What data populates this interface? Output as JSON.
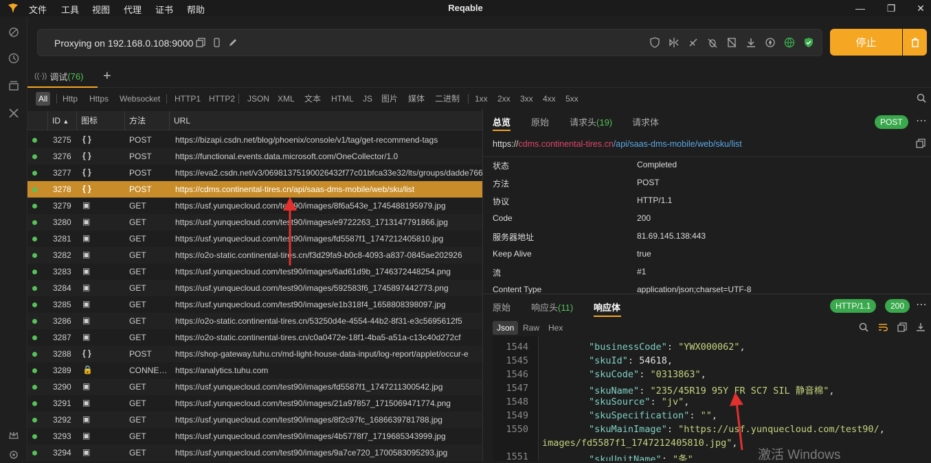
{
  "window": {
    "title": "Reqable",
    "menu": [
      "文件",
      "工具",
      "视图",
      "代理",
      "证书",
      "帮助"
    ]
  },
  "proxy": {
    "status": "Proxying on 192.168.0.108:9000",
    "stop_label": "停止"
  },
  "tabs": [
    {
      "label": "调试",
      "count": "(76)"
    }
  ],
  "filters": [
    "All",
    "Http",
    "Https",
    "Websocket",
    "HTTP1",
    "HTTP2",
    "JSON",
    "XML",
    "文本",
    "HTML",
    "JS",
    "图片",
    "媒体",
    "二进制",
    "1xx",
    "2xx",
    "3xx",
    "4xx",
    "5xx"
  ],
  "list": {
    "columns": [
      "ID",
      "图标",
      "方法",
      "URL"
    ],
    "rows": [
      {
        "id": "3275",
        "icon": "{ }",
        "method": "POST",
        "url": "https://bizapi.csdn.net/blog/phoenix/console/v1/tag/get-recommend-tags"
      },
      {
        "id": "3276",
        "icon": "{ }",
        "method": "POST",
        "url": "https://functional.events.data.microsoft.com/OneCollector/1.0"
      },
      {
        "id": "3277",
        "icon": "{ }",
        "method": "POST",
        "url": "https://eva2.csdn.net/v3/06981375190026432f77c01bfca33e32/lts/groups/dadde766"
      },
      {
        "id": "3278",
        "icon": "{ }",
        "method": "POST",
        "url": "https://cdms.continental-tires.cn/api/saas-dms-mobile/web/sku/list",
        "selected": true
      },
      {
        "id": "3279",
        "icon": "▣",
        "method": "GET",
        "url": "https://usf.yunquecloud.com/test90/images/8f6a543e_1745488195979.jpg"
      },
      {
        "id": "3280",
        "icon": "▣",
        "method": "GET",
        "url": "https://usf.yunquecloud.com/test90/images/e9722263_1713147791866.jpg"
      },
      {
        "id": "3281",
        "icon": "▣",
        "method": "GET",
        "url": "https://usf.yunquecloud.com/test90/images/fd5587f1_1747212405810.jpg"
      },
      {
        "id": "3282",
        "icon": "▣",
        "method": "GET",
        "url": "https://o2o-static.continental-tires.cn/f3d29fa9-b0c8-4093-a837-0845ae202926"
      },
      {
        "id": "3283",
        "icon": "▣",
        "method": "GET",
        "url": "https://usf.yunquecloud.com/test90/images/6ad61d9b_1746372448254.png"
      },
      {
        "id": "3284",
        "icon": "▣",
        "method": "GET",
        "url": "https://usf.yunquecloud.com/test90/images/592583f6_1745897442773.png"
      },
      {
        "id": "3285",
        "icon": "▣",
        "method": "GET",
        "url": "https://usf.yunquecloud.com/test90/images/e1b318f4_1658808398097.jpg"
      },
      {
        "id": "3286",
        "icon": "▣",
        "method": "GET",
        "url": "https://o2o-static.continental-tires.cn/53250d4e-4554-44b2-8f31-e3c5695612f5"
      },
      {
        "id": "3287",
        "icon": "▣",
        "method": "GET",
        "url": "https://o2o-static.continental-tires.cn/c0a0472e-18f1-4ba5-a51a-c13c40d272cf"
      },
      {
        "id": "3288",
        "icon": "{ }",
        "method": "POST",
        "url": "https://shop-gateway.tuhu.cn/md-light-house-data-input/log-report/applet/occur-e"
      },
      {
        "id": "3289",
        "icon": "🔒",
        "method": "CONNE…",
        "url": "https://analytics.tuhu.com"
      },
      {
        "id": "3290",
        "icon": "▣",
        "method": "GET",
        "url": "https://usf.yunquecloud.com/test90/images/fd5587f1_1747211300542.jpg"
      },
      {
        "id": "3291",
        "icon": "▣",
        "method": "GET",
        "url": "https://usf.yunquecloud.com/test90/images/21a97857_1715069471774.png"
      },
      {
        "id": "3292",
        "icon": "▣",
        "method": "GET",
        "url": "https://usf.yunquecloud.com/test90/images/8f2c97fc_1686639781788.jpg"
      },
      {
        "id": "3293",
        "icon": "▣",
        "method": "GET",
        "url": "https://usf.yunquecloud.com/test90/images/4b5778f7_1719685343999.jpg"
      },
      {
        "id": "3294",
        "icon": "▣",
        "method": "GET",
        "url": "https://usf.yunquecloud.com/test90/images/9a7ce720_1700583095293.jpg"
      }
    ]
  },
  "detail": {
    "tabs": [
      {
        "label": "总览"
      },
      {
        "label": "原始"
      },
      {
        "label": "请求头",
        "count": "(19)"
      },
      {
        "label": "请求体"
      }
    ],
    "method_badge": "POST",
    "url": {
      "scheme": "https://",
      "host": "cdms.continental-tires.cn",
      "path": "/api/saas-dms-mobile/web/sku/list"
    },
    "props": [
      {
        "k": "状态",
        "v": "Completed"
      },
      {
        "k": "方法",
        "v": "POST"
      },
      {
        "k": "协议",
        "v": "HTTP/1.1"
      },
      {
        "k": "Code",
        "v": "200"
      },
      {
        "k": "服务器地址",
        "v": "81.69.145.138:443"
      },
      {
        "k": "Keep Alive",
        "v": "true"
      },
      {
        "k": "流",
        "v": "#1"
      },
      {
        "k": "Content Type",
        "v": "application/json;charset=UTF-8"
      }
    ],
    "resp_tabs": [
      {
        "label": "原始"
      },
      {
        "label": "响应头",
        "count": "(11)"
      },
      {
        "label": "响应体"
      }
    ],
    "http_badge": "HTTP/1.1",
    "code_badge": "200",
    "formats": [
      "Json",
      "Raw",
      "Hex"
    ],
    "code_lines": [
      {
        "n": "1544",
        "key": "businessCode",
        "val": "\"YWX000062\""
      },
      {
        "n": "1545",
        "key": "skuId",
        "val": "54618"
      },
      {
        "n": "1546",
        "key": "skuCode",
        "val": "\"0313863\""
      },
      {
        "n": "1547",
        "key": "skuName",
        "val": "\"235/45R19 95Y FR SC7 SIL 静音棉\""
      },
      {
        "n": "1548",
        "key": "skuSource",
        "val": "\"jv\""
      },
      {
        "n": "1549",
        "key": "skuSpecification",
        "val": "\"\""
      },
      {
        "n": "1550",
        "key": "skuMainImage",
        "val": "\"https://usf.yunquecloud.com/test90/"
      },
      {
        "n": "",
        "key": "",
        "val": "images/fd5587f1_1747212405810.jpg\""
      },
      {
        "n": "1551",
        "key": "skuUnitName",
        "val": "\"条\""
      }
    ]
  },
  "watermark": "激活 Windows",
  "colors": {
    "accent": "#f5a623",
    "selected_row": "#c88d2a",
    "ok": "#3aa84c",
    "host": "#e0456a",
    "path": "#5aa9e6"
  }
}
